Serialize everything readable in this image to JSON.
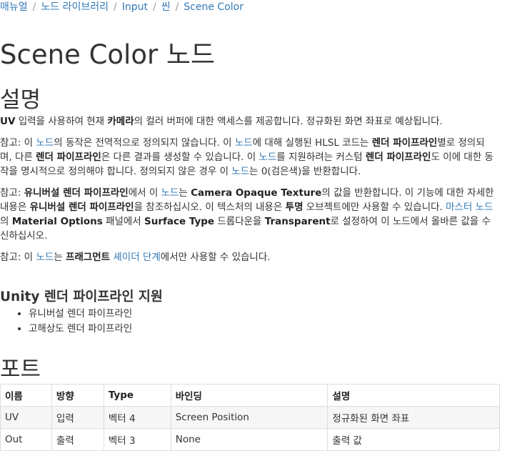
{
  "breadcrumb": [
    {
      "label": "매뉴얼"
    },
    {
      "label": "노드 라이브러리"
    },
    {
      "label": "Input"
    },
    {
      "label": "씬"
    },
    {
      "label": "Scene Color"
    }
  ],
  "page_title": "Scene Color 노드",
  "description": {
    "heading": "설명",
    "p1": {
      "s1": "UV",
      "t1": " 입력을 사용하여 현재 ",
      "s2": "카메라",
      "t2": "의 컬러 버퍼에 대한 액세스를 제공합니다. 정규화된 화면 좌표로 예상됩니다."
    },
    "p2": {
      "t1": "참고: 이 ",
      "l1": "노드",
      "t2": "의 동작은 전역적으로 정의되지 않습니다. 이 ",
      "l2": "노드",
      "t3": "에 대해 실행된 HLSL 코드는 ",
      "s1": "렌더 파이프라인",
      "t4": "별로 정의되며, 다른 ",
      "s2": "렌더 파이프라인",
      "t5": "은 다른 결과를 생성할 수 있습니다. 이 ",
      "l3": "노드",
      "t6": "를 지원하려는 커스텀 ",
      "s3": "렌더 파이프라인",
      "t7": "도 이에 대한 동작을 명시적으로 정의해야 합니다. 정의되지 않은 경우 이 ",
      "l4": "노드",
      "t8": "는 0(검은색)을 반환합니다."
    },
    "p3": {
      "t1": "참고: ",
      "s1": "유니버설 렌더 파이프라인",
      "t2": "에서 이 ",
      "l1": "노드",
      "t3": "는 ",
      "s2": "Camera Opaque Texture",
      "t4": "의 값을 반환합니다. 이 기능에 대한 자세한 내용은 ",
      "s3": "유니버설 렌더 파이프라인",
      "t5": "을 참조하십시오. 이 텍스처의 내용은 ",
      "s4": "투명",
      "t6": " 오브젝트에만 사용할 수 있습니다. ",
      "l2": "마스터 노드",
      "t7": "의 ",
      "s5": "Material Options",
      "t8": " 패널에서 ",
      "s6": "Surface Type",
      "t9": " 드롭다운을 ",
      "s7": "Transparent",
      "t10": "로 설정하여 이 노드에서 올바른 값을 수신하십시오."
    },
    "p4": {
      "t1": "참고: 이 ",
      "l1": "노드",
      "t2": "는 ",
      "s1": "프래그먼트",
      "t3": " ",
      "l2": "셰이더 단계",
      "t4": "에서만 사용할 수 있습니다."
    }
  },
  "pipelines": {
    "heading": "Unity 렌더 파이프라인 지원",
    "items": [
      "유니버설 렌더 파이프라인",
      "고해상도 렌더 파이프라인"
    ]
  },
  "ports": {
    "heading": "포트",
    "columns": [
      "이름",
      "방향",
      "Type",
      "바인딩",
      "설명"
    ],
    "rows": [
      [
        "UV",
        "입력",
        "벡터 4",
        "Screen Position",
        "정규화된 화면 좌표"
      ],
      [
        "Out",
        "출력",
        "벡터 3",
        "None",
        "출력 값"
      ]
    ]
  }
}
